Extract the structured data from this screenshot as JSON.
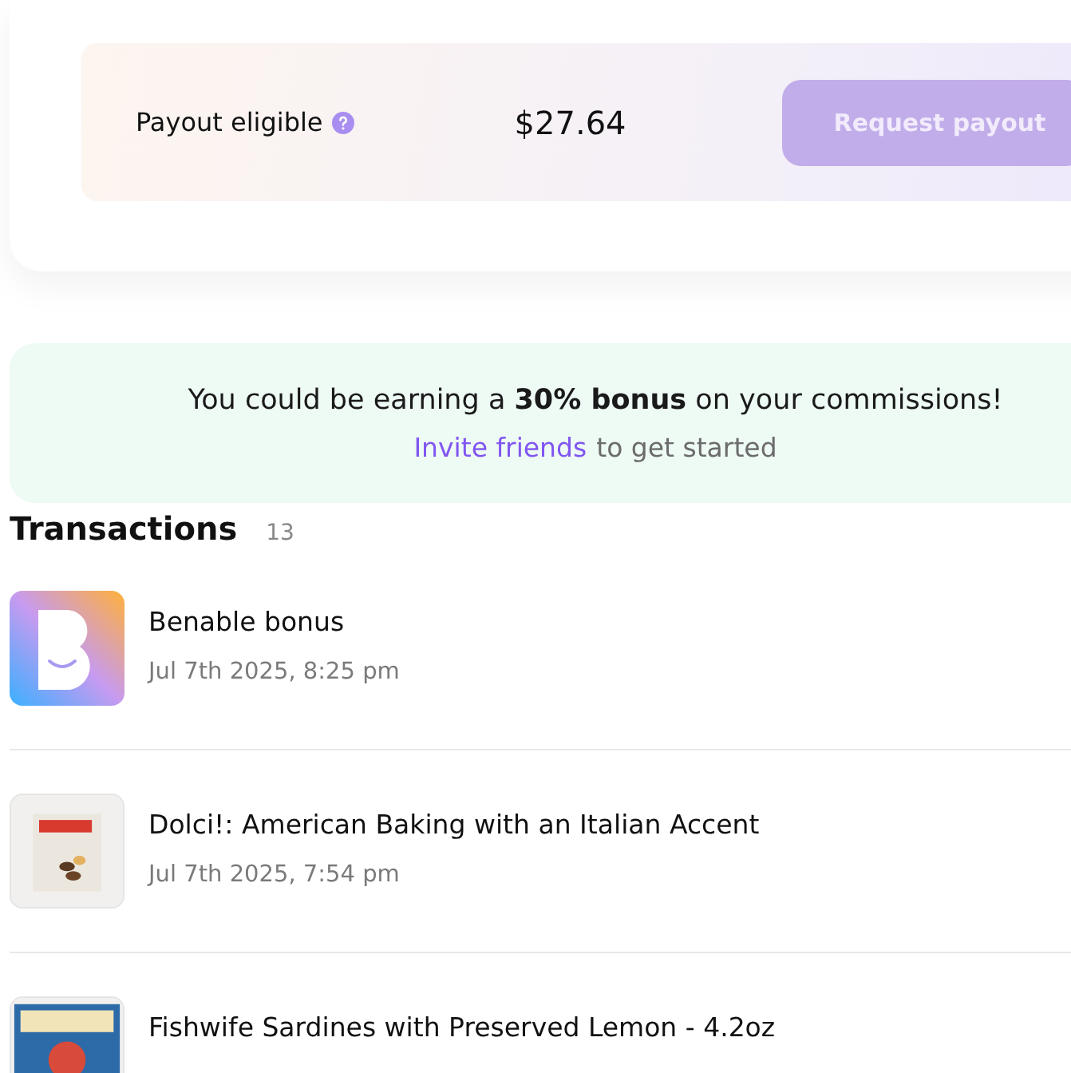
{
  "payout": {
    "label": "Payout eligible",
    "amount": "$27.64",
    "button": "Request payout",
    "button_disabled": true
  },
  "banner": {
    "text": "You could be earning a **30% bonus** on your commissions!",
    "link": "Invite friends",
    "link_rest": "to get started"
  },
  "transactions": {
    "title": "Transactions",
    "count": "13",
    "items": [
      {
        "kind": "bonus",
        "title": "Benable bonus",
        "date": "Jul 7th 2025, 8:25 pm"
      },
      {
        "kind": "picture",
        "title": "Dolci!: American Baking with an Italian Accent",
        "date": "Jul 7th 2025, 7:54 pm"
      },
      {
        "kind": "picture",
        "title": "Fishwife Sardines with Preserved Lemon - 4.2oz"
      }
    ]
  }
}
